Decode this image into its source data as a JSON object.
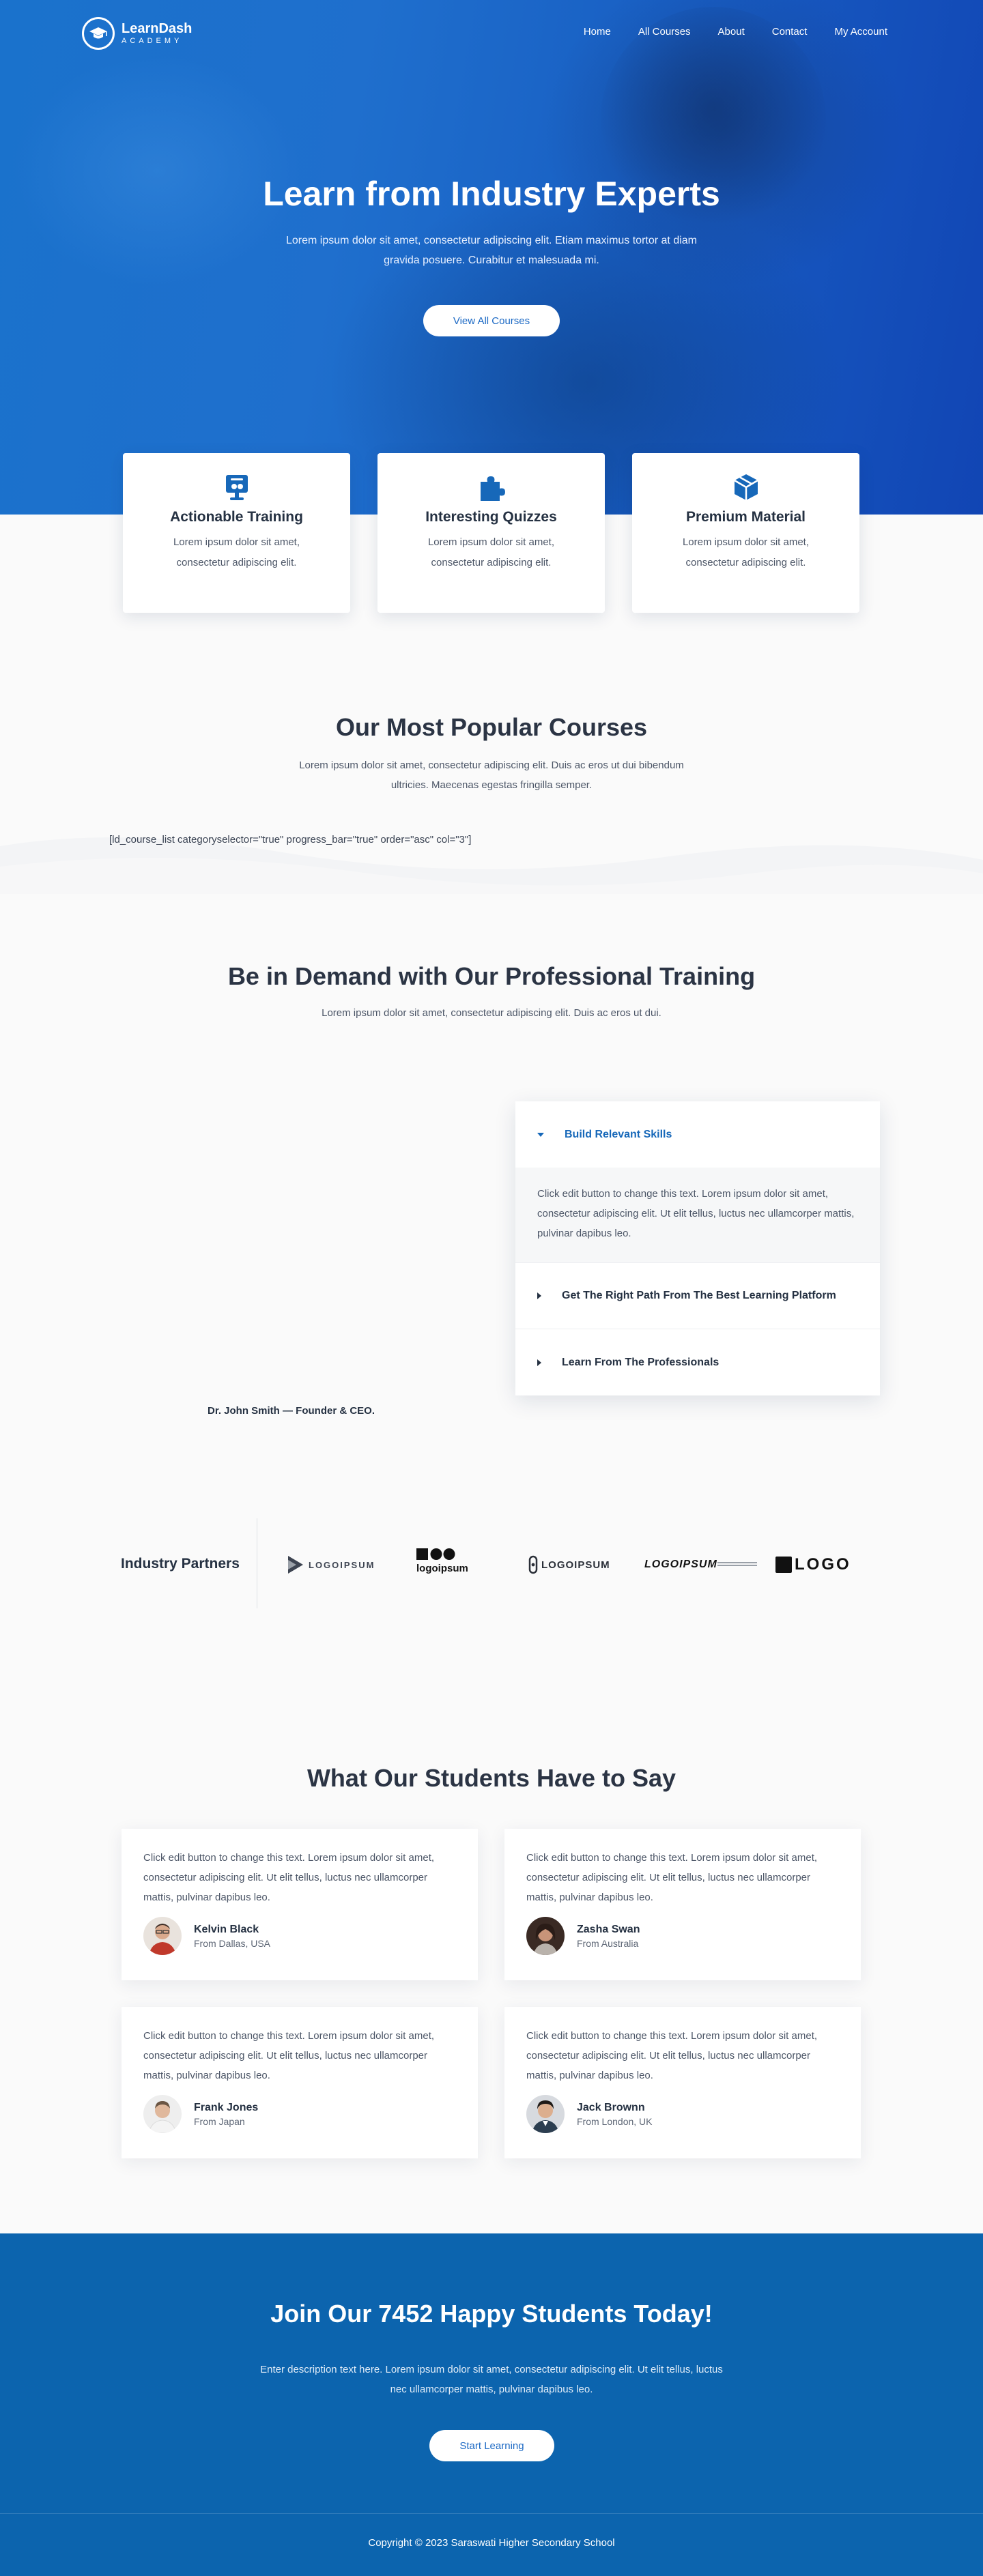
{
  "brand": {
    "name": "LearnDash",
    "tagline": "ACADEMY",
    "icon": "graduation-cap-icon"
  },
  "nav": {
    "items": [
      "Home",
      "All Courses",
      "About",
      "Contact",
      "My Account"
    ]
  },
  "hero": {
    "title": "Learn from Industry Experts",
    "subtitle": "Lorem ipsum dolor sit amet, consectetur adipiscing elit. Etiam maximus tortor at diam gravida posuere. Curabitur et malesuada mi.",
    "button": "View All Courses"
  },
  "features": [
    {
      "title": "Actionable Training",
      "text": "Lorem ipsum dolor sit amet, consectetur adipiscing elit.",
      "icon": "presentation-icon"
    },
    {
      "title": "Interesting Quizzes",
      "text": "Lorem ipsum dolor sit amet, consectetur adipiscing elit.",
      "icon": "puzzle-icon"
    },
    {
      "title": "Premium Material",
      "text": "Lorem ipsum dolor sit amet, consectetur adipiscing elit.",
      "icon": "box-icon"
    }
  ],
  "popular": {
    "title": "Our Most Popular Courses",
    "text": "Lorem ipsum dolor sit amet, consectetur adipiscing elit. Duis ac eros ut dui bibendum ultricies. Maecenas egestas fringilla semper.",
    "shortcode": "[ld_course_list categoryselector=\"true\" progress_bar=\"true\" order=\"asc\" col=\"3\"]"
  },
  "training": {
    "title": "Be in Demand with Our Professional Training",
    "text": "Lorem ipsum dolor sit amet, consectetur adipiscing elit. Duis ac eros ut dui.",
    "founder": "Dr. John Smith — Founder & CEO.",
    "accordion": [
      {
        "title": "Build Relevant Skills",
        "body": "Click edit button to change this text. Lorem ipsum dolor sit amet, consectetur adipiscing elit. Ut elit tellus, luctus nec ullamcorper mattis, pulvinar dapibus leo."
      },
      {
        "title": "Get The Right Path From The Best Learning Platform"
      },
      {
        "title": "Learn From The Professionals"
      }
    ]
  },
  "partners": {
    "title": "Industry Partners",
    "logos": [
      "LOGOIPSUM",
      "logoipsum",
      "LOGOIPSUM",
      "LOGOIPSUM",
      "LOGO"
    ]
  },
  "testimonials": {
    "title": "What Our Students Have to Say",
    "items": [
      {
        "text": "Click edit button to change this text. Lorem ipsum dolor sit amet, consectetur adipiscing elit. Ut elit tellus, luctus nec ullamcorper mattis, pulvinar dapibus leo.",
        "name": "Kelvin Black",
        "from": "From Dallas, USA"
      },
      {
        "text": "Click edit button to change this text. Lorem ipsum dolor sit amet, consectetur adipiscing elit. Ut elit tellus, luctus nec ullamcorper mattis, pulvinar dapibus leo.",
        "name": "Zasha Swan",
        "from": "From Australia"
      },
      {
        "text": "Click edit button to change this text. Lorem ipsum dolor sit amet, consectetur adipiscing elit. Ut elit tellus, luctus nec ullamcorper mattis, pulvinar dapibus leo.",
        "name": "Frank Jones",
        "from": "From Japan"
      },
      {
        "text": "Click edit button to change this text. Lorem ipsum dolor sit amet, consectetur adipiscing elit. Ut elit tellus, luctus nec ullamcorper mattis, pulvinar dapibus leo.",
        "name": "Jack Brownn",
        "from": "From London, UK"
      }
    ]
  },
  "cta": {
    "title": "Join Our 7452 Happy Students Today!",
    "text": "Enter description text here. Lorem ipsum dolor sit amet, consectetur adipiscing elit. Ut elit tellus, luctus nec ullamcorper mattis, pulvinar dapibus leo.",
    "button": "Start Learning"
  },
  "footer": {
    "copyright": "Copyright © 2023 Saraswati Higher Secondary School"
  },
  "colors": {
    "primary": "#1768b9",
    "hero_start": "#1a72cc",
    "hero_end": "#1145b4",
    "cta_bg": "#0c64ae",
    "heading": "#2b3444"
  }
}
